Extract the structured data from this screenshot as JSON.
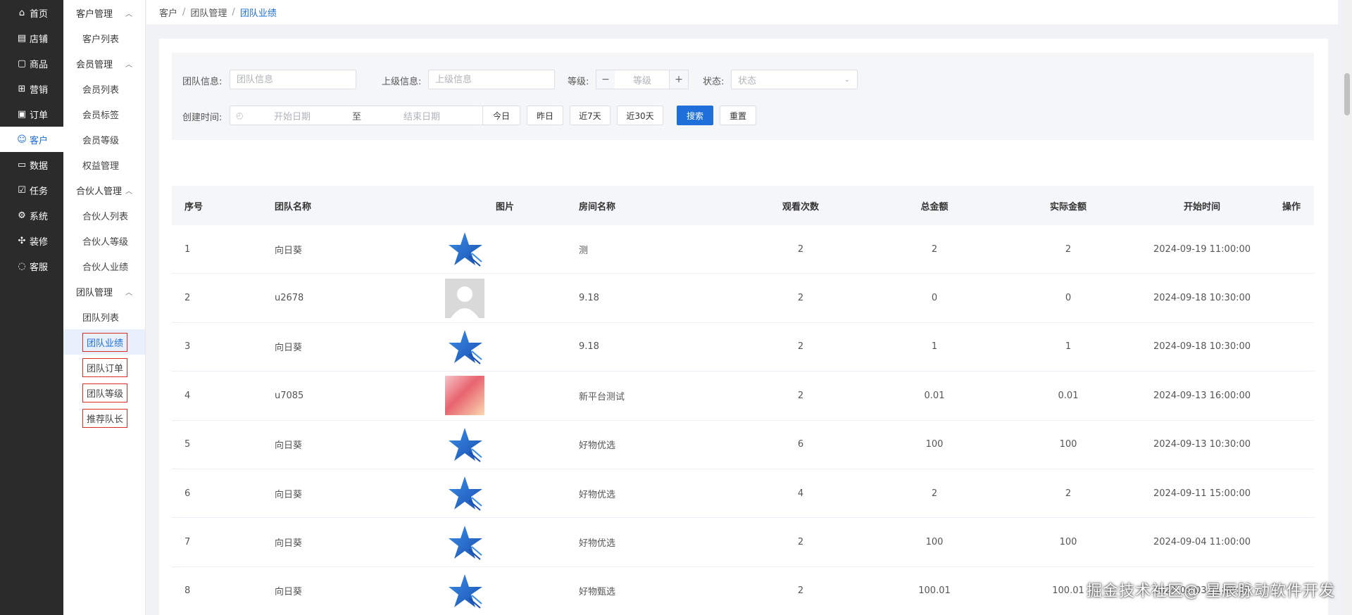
{
  "primary_nav": [
    {
      "label": "首页",
      "icon": "home-icon"
    },
    {
      "label": "店铺",
      "icon": "store-icon"
    },
    {
      "label": "商品",
      "icon": "goods-icon"
    },
    {
      "label": "营销",
      "icon": "gift-icon"
    },
    {
      "label": "订单",
      "icon": "order-icon"
    },
    {
      "label": "客户",
      "icon": "customer-icon"
    },
    {
      "label": "数据",
      "icon": "data-icon"
    },
    {
      "label": "任务",
      "icon": "task-icon"
    },
    {
      "label": "系统",
      "icon": "system-icon"
    },
    {
      "label": "装修",
      "icon": "decorate-icon"
    },
    {
      "label": "客服",
      "icon": "chat-icon"
    }
  ],
  "sub_nav": {
    "groups": [
      {
        "label": "客户管理",
        "items": [
          "客户列表"
        ]
      },
      {
        "label": "会员管理",
        "items": [
          "会员列表",
          "会员标签",
          "会员等级",
          "权益管理"
        ]
      },
      {
        "label": "合伙人管理",
        "items": [
          "合伙人列表",
          "合伙人等级",
          "合伙人业绩"
        ]
      },
      {
        "label": "团队管理",
        "items": [
          "团队列表",
          "团队业绩",
          "团队订单",
          "团队等级",
          "推荐队长"
        ]
      }
    ]
  },
  "breadcrumb": [
    "客户",
    "团队管理",
    "团队业绩"
  ],
  "filters": {
    "team_info_label": "团队信息:",
    "team_info_placeholder": "团队信息",
    "superior_label": "上级信息:",
    "superior_placeholder": "上级信息",
    "level_label": "等级:",
    "level_placeholder": "等级",
    "status_label": "状态:",
    "status_placeholder": "状态",
    "created_label": "创建时间:",
    "start_placeholder": "开始日期",
    "range_sep": "至",
    "end_placeholder": "结束日期",
    "quick_today": "今日",
    "quick_yesterday": "昨日",
    "quick_7": "近7天",
    "quick_30": "近30天",
    "search": "搜索",
    "reset": "重置"
  },
  "table": {
    "headers": [
      "序号",
      "团队名称",
      "图片",
      "房间名称",
      "观看次数",
      "总金额",
      "实际金额",
      "开始时间",
      "操作"
    ],
    "rows": [
      {
        "no": "1",
        "team": "向日葵",
        "img": "star",
        "room": "测",
        "views": "2",
        "total": "2",
        "actual": "2",
        "start": "2024-09-19 11:00:00"
      },
      {
        "no": "2",
        "team": "u2678",
        "img": "avatar",
        "room": "9.18",
        "views": "2",
        "total": "0",
        "actual": "0",
        "start": "2024-09-18 10:30:00"
      },
      {
        "no": "3",
        "team": "向日葵",
        "img": "star",
        "room": "9.18",
        "views": "2",
        "total": "1",
        "actual": "1",
        "start": "2024-09-18 10:30:00"
      },
      {
        "no": "4",
        "team": "u7085",
        "img": "poster",
        "room": "新平台测试",
        "views": "2",
        "total": "0.01",
        "actual": "0.01",
        "start": "2024-09-13 16:00:00"
      },
      {
        "no": "5",
        "team": "向日葵",
        "img": "star",
        "room": "好物优选",
        "views": "6",
        "total": "100",
        "actual": "100",
        "start": "2024-09-13 10:30:00"
      },
      {
        "no": "6",
        "team": "向日葵",
        "img": "star",
        "room": "好物优选",
        "views": "4",
        "total": "2",
        "actual": "2",
        "start": "2024-09-11 15:00:00"
      },
      {
        "no": "7",
        "team": "向日葵",
        "img": "star",
        "room": "好物优选",
        "views": "2",
        "total": "100",
        "actual": "100",
        "start": "2024-09-04 11:00:00"
      },
      {
        "no": "8",
        "team": "向日葵",
        "img": "star",
        "room": "好物甄选",
        "views": "2",
        "total": "100.01",
        "actual": "100.01",
        "start": "2024-09-03 11:00:00"
      }
    ]
  },
  "watermark": "掘金技术社区@ 星辰脉动软件开发"
}
